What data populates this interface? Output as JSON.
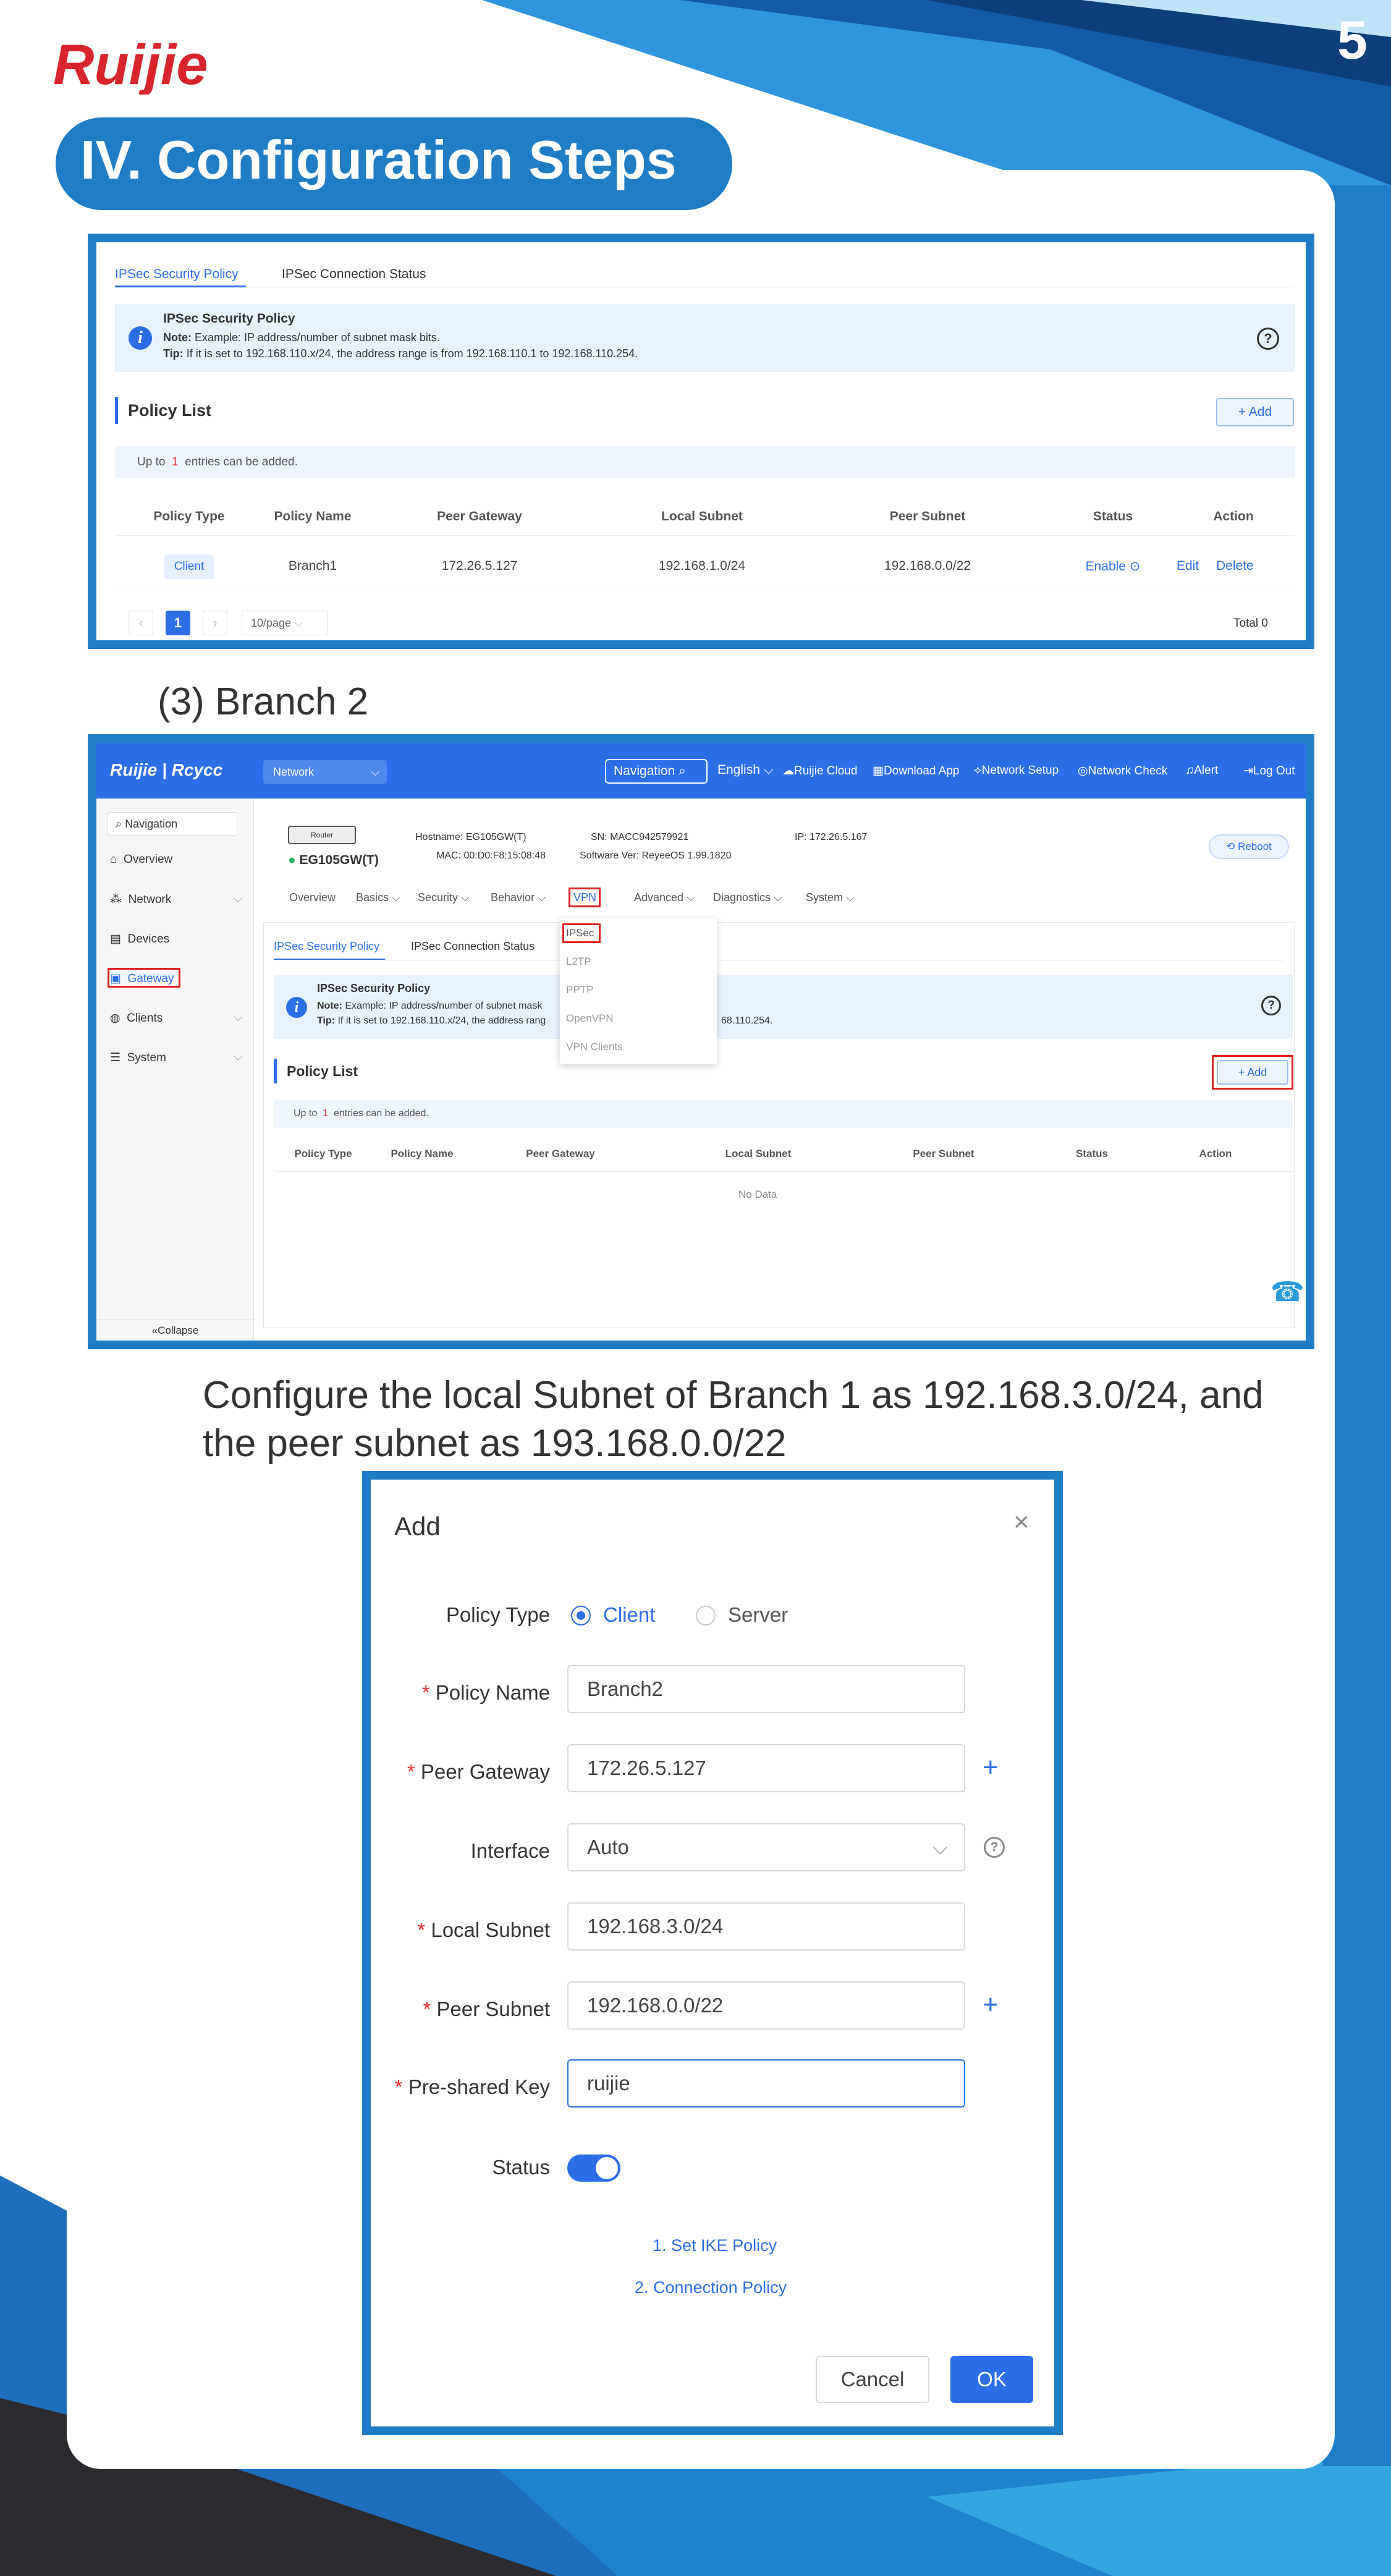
{
  "page": {
    "brand": "Ruijie",
    "page_number": "5",
    "section_title": "IV. Configuration Steps",
    "caption_branch2": "(3) Branch 2",
    "instruction_line1": "Configure the local Subnet of Branch 1 as 192.168.3.0/24, and",
    "instruction_line2": "the peer subnet as 193.168.0.0/22",
    "colors": {
      "primary_blue": "#1f7dc6",
      "ui_blue": "#2b6ee8",
      "brand_red": "#d7252b"
    }
  },
  "shot1": {
    "tabs": [
      "IPSec Security Policy",
      "IPSec Connection Status"
    ],
    "info": {
      "title": "IPSec Security Policy",
      "note_label": "Note:",
      "note": "Example: IP address/number of subnet mask bits.",
      "tip_label": "Tip:",
      "tip": "If it is set to 192.168.110.x/24, the address range is from 192.168.110.1 to 192.168.110.254."
    },
    "policy_list_title": "Policy List",
    "add_label": "+ Add",
    "limit_prefix": "Up to",
    "limit_count": "1",
    "limit_suffix": "entries can be added.",
    "columns": [
      "Policy Type",
      "Policy Name",
      "Peer Gateway",
      "Local Subnet",
      "Peer Subnet",
      "Status",
      "Action"
    ],
    "row": {
      "policy_type": "Client",
      "policy_name": "Branch1",
      "peer_gateway": "172.26.5.127",
      "local_subnet": "192.168.1.0/24",
      "peer_subnet": "192.168.0.0/22",
      "status": "Enable",
      "edit": "Edit",
      "delete": "Delete"
    },
    "pagination": {
      "current": "1",
      "page_size": "10/page",
      "total": "Total 0"
    }
  },
  "shot2": {
    "logo": "Ruijie | Rcycc",
    "network_select": "Network",
    "header_links": [
      "Navigation",
      "English",
      "Ruijie Cloud",
      "Download App",
      "Network Setup",
      "Network Check",
      "Alert",
      "Log Out"
    ],
    "sidebar": [
      "Navigation",
      "Overview",
      "Network",
      "Devices",
      "Gateway",
      "Clients",
      "System"
    ],
    "collapse": "«Collapse",
    "device": {
      "model_label": "Router",
      "name": "EG105GW(T)",
      "hostname": "Hostname: EG105GW(T)",
      "mac": "MAC: 00:D0:F8:15:08:48",
      "sn": "SN: MACC942579921",
      "software": "Software Ver: ReyeeOS 1.99.1820",
      "ip": "IP: 172.26.5.167",
      "reboot": "Reboot"
    },
    "menu": [
      "Overview",
      "Basics",
      "Security",
      "Behavior",
      "VPN",
      "Advanced",
      "Diagnostics",
      "System"
    ],
    "vpn_dropdown": [
      "IPSec",
      "L2TP",
      "PPTP",
      "OpenVPN",
      "VPN Clients"
    ],
    "tabs": [
      "IPSec Security Policy",
      "IPSec Connection Status"
    ],
    "info": {
      "title": "IPSec Security Policy",
      "note_label": "Note:",
      "note": "Example: IP address/number of subnet mask",
      "tip_label": "Tip:",
      "tip": "If it is set to 192.168.110.x/24, the address rang",
      "tip_end": "68.110.254."
    },
    "policy_list_title": "Policy List",
    "add_label": "+ Add",
    "limit_prefix": "Up to",
    "limit_count": "1",
    "limit_suffix": "entries can be added.",
    "columns": [
      "Policy Type",
      "Policy Name",
      "Peer Gateway",
      "Local Subnet",
      "Peer Subnet",
      "Status",
      "Action"
    ],
    "empty": "No Data"
  },
  "dialog": {
    "title": "Add",
    "policy_type_label": "Policy Type",
    "client": "Client",
    "server": "Server",
    "policy_name_label": "Policy Name",
    "policy_name": "Branch2",
    "peer_gateway_label": "Peer Gateway",
    "peer_gateway": "172.26.5.127",
    "interface_label": "Interface",
    "interface": "Auto",
    "local_subnet_label": "Local Subnet",
    "local_subnet": "192.168.3.0/24",
    "peer_subnet_label": "Peer Subnet",
    "peer_subnet": "192.168.0.0/22",
    "psk_label": "Pre-shared Key",
    "psk": "ruijie",
    "status_label": "Status",
    "status_on": true,
    "link1": "1. Set IKE Policy",
    "link2": "2. Connection Policy",
    "cancel": "Cancel",
    "ok": "OK"
  }
}
